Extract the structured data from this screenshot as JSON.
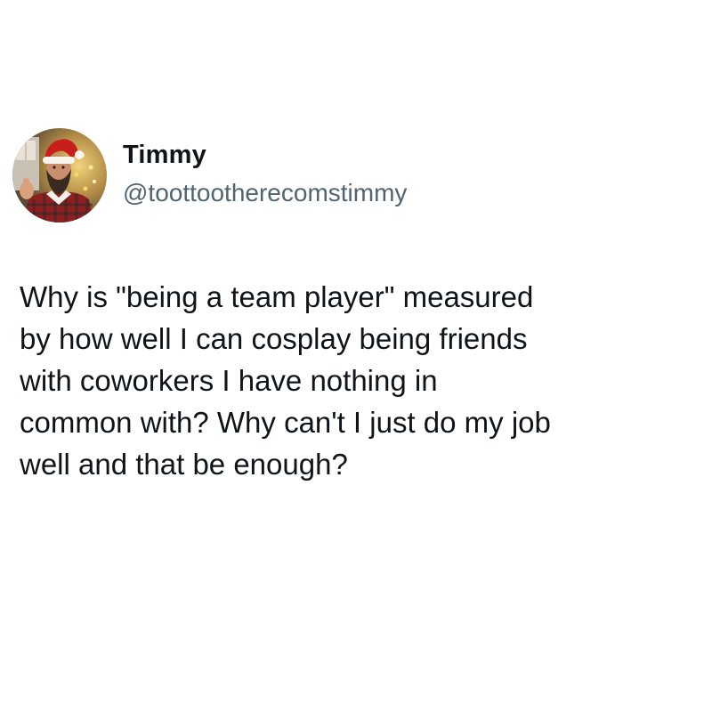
{
  "user": {
    "display_name": "Timmy",
    "handle": "@toottootherecomstimmy",
    "avatar_icon": "profile-photo-santa-hat-man"
  },
  "tweet": {
    "lines": [
      "Why is \"being a team player\" measured",
      "by how well I can cosplay being friends",
      "with coworkers I have nothing in",
      "common with? Why can't I just do my job",
      "well and that be enough?"
    ]
  },
  "colors": {
    "text": "#0f1419",
    "handle": "#536471",
    "background": "#ffffff"
  }
}
